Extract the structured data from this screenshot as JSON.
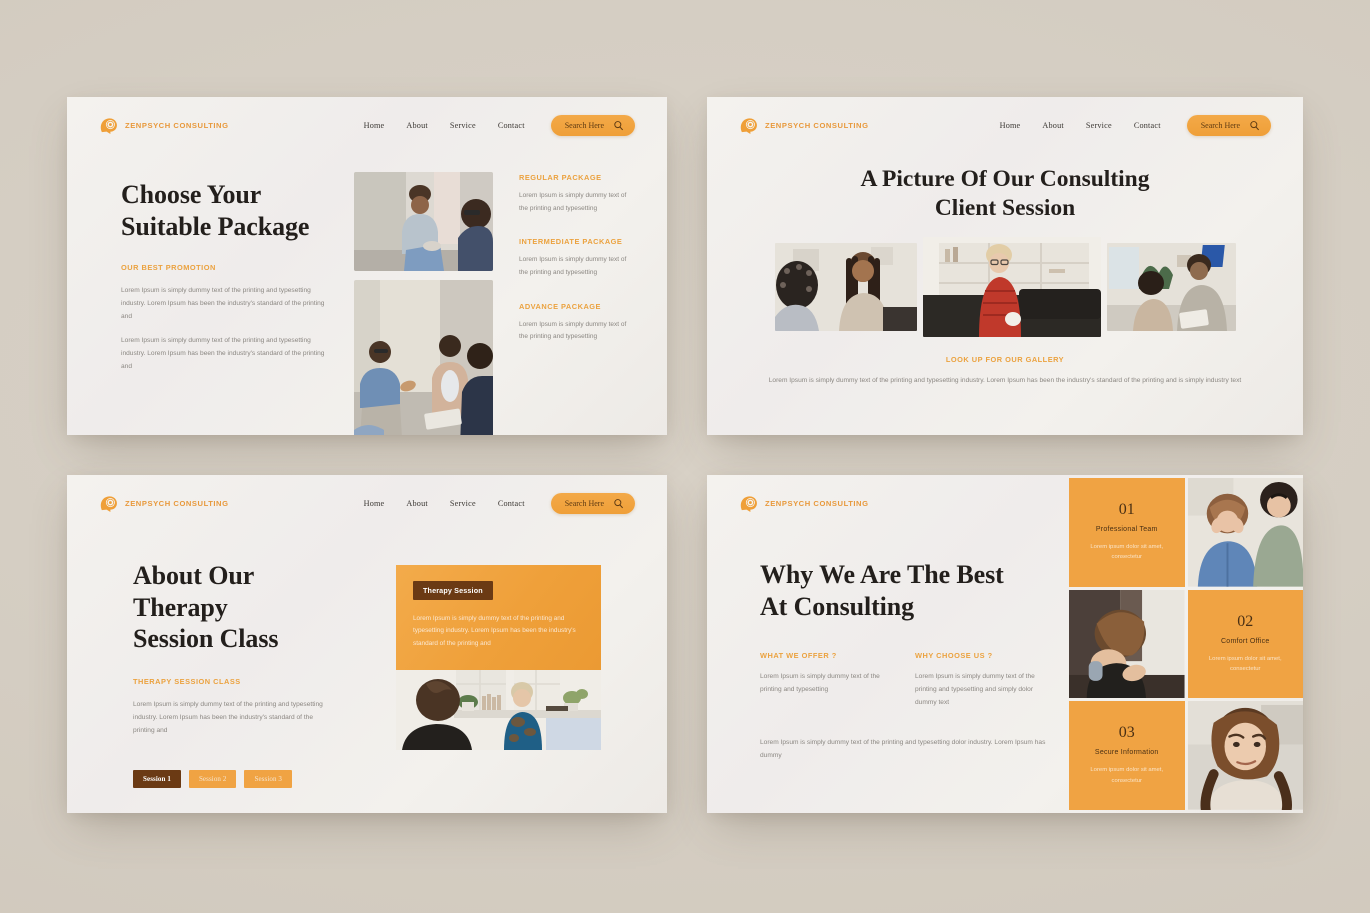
{
  "brand": {
    "name": "ZENPSYCH CONSULTING",
    "accent": "#f0a343",
    "accent_dark": "#6b3a14",
    "page_background": "#d4ccc1"
  },
  "nav": {
    "links": [
      "Home",
      "About",
      "Service",
      "Contact"
    ],
    "search_label": "Search Here"
  },
  "slides": [
    {
      "id": "choose-your-suitable-package",
      "headline_lines": [
        "Choose Your",
        "Suitable Package"
      ],
      "eyebrow": "OUR BEST PROMOTION",
      "paragraphs": [
        "Lorem Ipsum is simply dummy text of the printing and typesetting industry. Lorem Ipsum has been the industry's standard of the printing and",
        "Lorem Ipsum is simply dummy text of the printing and typesetting industry. Lorem Ipsum has been the industry's standard of the printing and"
      ],
      "packages": [
        {
          "title": "REGULAR PACKAGE",
          "desc": "Lorem Ipsum is simply dummy text of the printing and typesetting"
        },
        {
          "title": "INTERMEDIATE PACKAGE",
          "desc": "Lorem Ipsum is simply dummy text of the printing and typesetting"
        },
        {
          "title": "ADVANCE PACKAGE",
          "desc": "Lorem Ipsum is simply dummy text of the printing and typesetting"
        }
      ],
      "photos": [
        "therapist-and-client-session-photo",
        "group-therapy-circle-photo"
      ]
    },
    {
      "id": "a-picture-of-our-consulting-client-session",
      "title_lines": [
        "A Picture Of Our Consulting",
        "Client Session"
      ],
      "gallery": [
        "two-clients-talking-photo",
        "woman-in-red-with-mug-photo",
        "counsellor-taking-notes-photo"
      ],
      "footer_eyebrow": "LOOK UP FOR OUR GALLERY",
      "footer_text": "Lorem Ipsum is simply dummy text of the printing and typesetting industry. Lorem Ipsum has been the industry's standard of the printing and is simply industry text"
    },
    {
      "id": "about-our-therapy-session-class",
      "headline_lines": [
        "About Our Therapy",
        "Session Class"
      ],
      "eyebrow": "THERAPY SESSION CLASS",
      "paragraph": "Lorem Ipsum is simply dummy text of the printing and typesetting industry. Lorem Ipsum has been the industry's standard of the printing and",
      "session_tabs": [
        {
          "label": "Session 1",
          "state": "active"
        },
        {
          "label": "Session 2",
          "state": "idle"
        },
        {
          "label": "Session 3",
          "state": "idle"
        }
      ],
      "card": {
        "chip": "Therapy Session",
        "text": "Lorem Ipsum is simply dummy text of the printing and typesetting industry. Lorem Ipsum has been the industry's standard of the printing and"
      },
      "photo": "two-women-in-conversation-photo"
    },
    {
      "id": "why-we-are-the-best-at-consulting",
      "headline_lines": [
        "Why We Are The Best",
        "At Consulting"
      ],
      "columns": [
        {
          "eyebrow": "WHAT WE OFFER ?",
          "text": "Lorem Ipsum is simply dummy text of the printing and typesetting"
        },
        {
          "eyebrow": "WHY CHOOSE US ?",
          "text": "Lorem Ipsum is simply dummy text of the printing and typesetting and simply dolor dummy text"
        }
      ],
      "bottom_text": "Lorem Ipsum is simply dummy text of the printing and typesetting dolor industry. Lorem Ipsum has dummy",
      "features": [
        {
          "number": "01",
          "label": "Professional Team",
          "desc": "Lorem ipsum dolor sit amet, consectetur"
        },
        {
          "number": "02",
          "label": "Comfort Office",
          "desc": "Lorem ipsum dolor sit amet, consectetur"
        },
        {
          "number": "03",
          "label": "Secure Information",
          "desc": "Lorem ipsum dolor sit amet, consectetur"
        }
      ],
      "feature_photos": [
        "distressed-woman-comforted-photo",
        "woman-head-down-photo",
        "portrait-of-worried-woman-photo"
      ]
    }
  ]
}
